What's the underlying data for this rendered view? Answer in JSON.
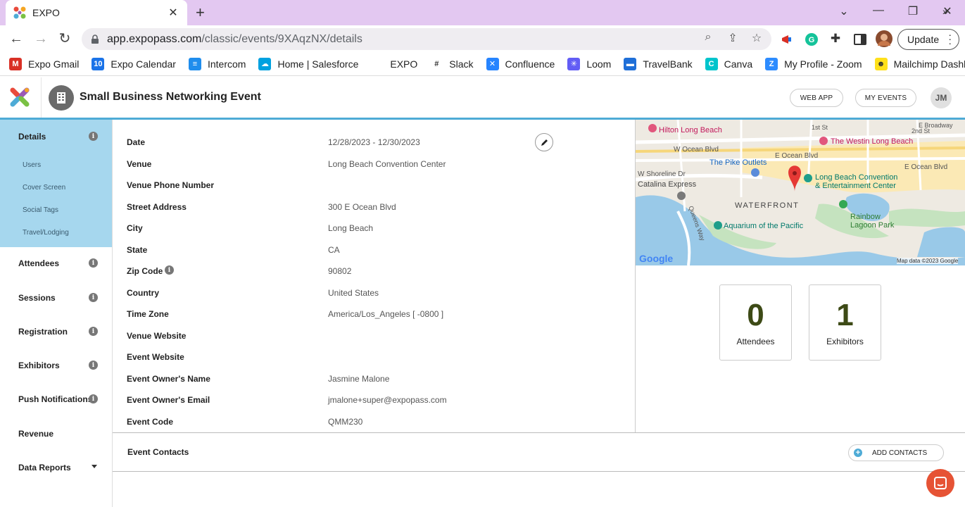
{
  "browser": {
    "tab_title": "EXPO",
    "url_host": "app.expopass.com",
    "url_path": "/classic/events/9XAqzNX/details",
    "update_label": "Update",
    "bookmarks": [
      {
        "label": "Expo Gmail",
        "icon": "gmail-icon",
        "color": "#d93025",
        "glyph": "M"
      },
      {
        "label": "Expo Calendar",
        "icon": "calendar-icon",
        "color": "#1a73e8",
        "glyph": "10"
      },
      {
        "label": "Intercom",
        "icon": "intercom-icon",
        "color": "#1f8ded",
        "glyph": "≡"
      },
      {
        "label": "Home | Salesforce",
        "icon": "salesforce-icon",
        "color": "#00a1e0",
        "glyph": "☁"
      },
      {
        "label": "EXPO",
        "icon": "expo-icon",
        "color": "#ffffff",
        "glyph": ""
      },
      {
        "label": "Slack",
        "icon": "slack-icon",
        "color": "#ffffff",
        "glyph": "#"
      },
      {
        "label": "Confluence",
        "icon": "confluence-icon",
        "color": "#2684ff",
        "glyph": "✕"
      },
      {
        "label": "Loom",
        "icon": "loom-icon",
        "color": "#625df5",
        "glyph": "✳"
      },
      {
        "label": "TravelBank",
        "icon": "travelbank-icon",
        "color": "#1f6fd8",
        "glyph": "▬"
      },
      {
        "label": "Canva",
        "icon": "canva-icon",
        "color": "#00c4cc",
        "glyph": "C"
      },
      {
        "label": "My Profile - Zoom",
        "icon": "zoom-icon",
        "color": "#2d8cff",
        "glyph": "Z"
      },
      {
        "label": "Mailchimp Dashboa...",
        "icon": "mailchimp-icon",
        "color": "#ffe01b",
        "glyph": "☻"
      }
    ]
  },
  "header": {
    "event_title": "Small Business Networking Event",
    "web_app_label": "WEB APP",
    "my_events_label": "MY EVENTS",
    "user_initials": "JM"
  },
  "sidebar": {
    "items": [
      {
        "label": "Details",
        "info": true
      },
      {
        "label": "Attendees",
        "info": true
      },
      {
        "label": "Sessions",
        "info": true
      },
      {
        "label": "Registration",
        "info": true
      },
      {
        "label": "Exhibitors",
        "info": true
      },
      {
        "label": "Push Notifications",
        "info": true
      },
      {
        "label": "Revenue",
        "info": false
      },
      {
        "label": "Data Reports",
        "info": false
      }
    ],
    "subitems": [
      "Users",
      "Cover Screen",
      "Social Tags",
      "Travel/Lodging"
    ]
  },
  "details": {
    "rows": [
      {
        "label": "Date",
        "value": "12/28/2023 - 12/30/2023"
      },
      {
        "label": "Venue",
        "value": "Long Beach Convention Center"
      },
      {
        "label": "Venue Phone Number",
        "value": ""
      },
      {
        "label": "Street Address",
        "value": "300 E Ocean Blvd"
      },
      {
        "label": "City",
        "value": "Long Beach"
      },
      {
        "label": "State",
        "value": "CA"
      },
      {
        "label": "Zip Code",
        "value": "90802"
      },
      {
        "label": "Country",
        "value": "United States"
      },
      {
        "label": "Time Zone",
        "value": "America/Los_Angeles [ -0800 ]"
      },
      {
        "label": "Venue Website",
        "value": ""
      },
      {
        "label": "Event Website",
        "value": ""
      },
      {
        "label": "Event Owner's Name",
        "value": "Jasmine Malone"
      },
      {
        "label": "Event Owner's Email",
        "value": "jmalone+super@expopass.com"
      },
      {
        "label": "Event Code",
        "value": "QMM230"
      }
    ]
  },
  "contacts": {
    "label": "Event Contacts",
    "add_label": "ADD CONTACTS"
  },
  "map": {
    "labels": {
      "hilton": "Hilton Long Beach",
      "westin": "The Westin Long Beach",
      "broadway": "E Broadway",
      "st2": "2nd St",
      "st1": "1st St",
      "w_ocean": "W Ocean Blvd",
      "e_ocean": "E Ocean Blvd",
      "e_ocean2": "E Ocean Blvd",
      "pike": "The Pike Outlets",
      "shoreline": "W Shoreline Dr",
      "catalina": "Catalina Express",
      "lbcc1": "Long Beach Convention",
      "lbcc2": "& Entertainment Center",
      "waterfront": "WATERFRONT",
      "rainbow1": "Rainbow",
      "rainbow2": "Lagoon Park",
      "aquarium": "Aquarium of the Pacific",
      "queens": "Queens Way",
      "google": "Google",
      "attribution": "Map data ©2023 Google"
    }
  },
  "stats": {
    "attendees_count": "0",
    "attendees_label": "Attendees",
    "exhibitors_count": "1",
    "exhibitors_label": "Exhibitors"
  },
  "colors": {
    "accent": "#4eabd6",
    "sidebar_active": "#a6d7ee",
    "tabbar": "#e3c8f1",
    "stat_number": "#3d4a16",
    "chat_fab": "#e65335"
  }
}
